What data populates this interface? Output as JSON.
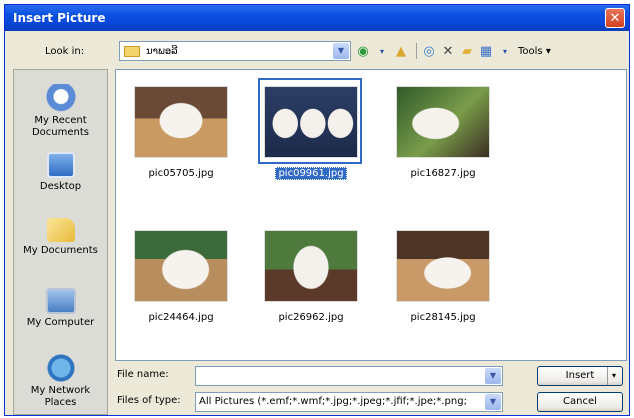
{
  "window": {
    "title": "Insert Picture",
    "close_glyph": "✕"
  },
  "lookin": {
    "label": "Look in:",
    "value": "ນາພອລີ",
    "arrow_icon": "chevron-down-icon"
  },
  "toolbar": {
    "tools_label": "Tools ▾"
  },
  "places": [
    {
      "label": "My Recent Documents",
      "icon": "recent-documents-icon",
      "color": "#5b8bd6"
    },
    {
      "label": "Desktop",
      "icon": "desktop-icon",
      "color": "#3a7bd5"
    },
    {
      "label": "My Documents",
      "icon": "my-documents-icon",
      "color": "#f2c94c"
    },
    {
      "label": "My Computer",
      "icon": "my-computer-icon",
      "color": "#6f8fb8"
    },
    {
      "label": "My Network Places",
      "icon": "network-places-icon",
      "color": "#3d7fc4"
    }
  ],
  "files": [
    {
      "name": "pic05705.jpg",
      "selected": false
    },
    {
      "name": "pic09961.jpg",
      "selected": true
    },
    {
      "name": "pic16827.jpg",
      "selected": false
    },
    {
      "name": "pic24464.jpg",
      "selected": false
    },
    {
      "name": "pic26962.jpg",
      "selected": false
    },
    {
      "name": "pic28145.jpg",
      "selected": false
    }
  ],
  "footer": {
    "filename_label": "File name:",
    "filename_value": "",
    "filetype_label": "Files of type:",
    "filetype_value": "All Pictures (*.emf;*.wmf;*.jpg;*.jpeg;*.jfif;*.jpe;*.png;",
    "insert_label": "Insert",
    "cancel_label": "Cancel"
  }
}
